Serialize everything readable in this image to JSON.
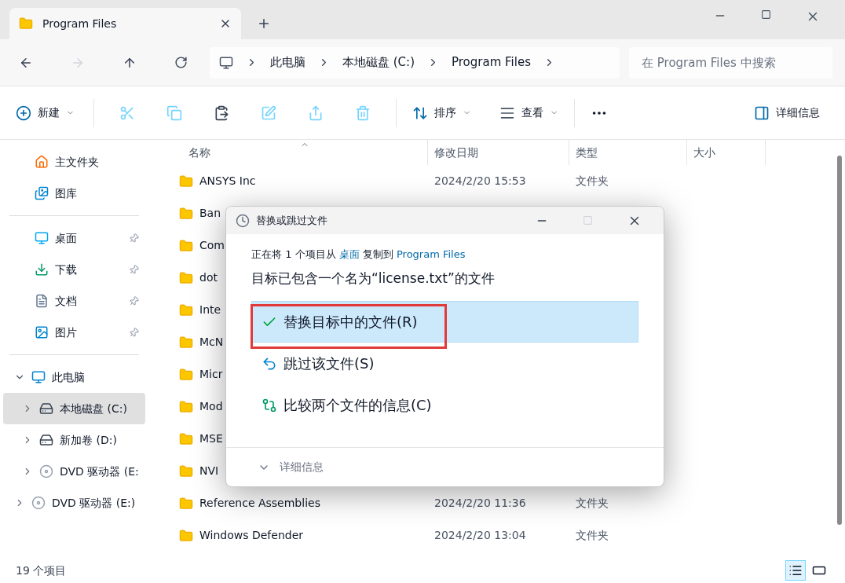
{
  "tab": {
    "title": "Program Files",
    "selected": true
  },
  "address": {
    "path": [
      {
        "label": "此电脑"
      },
      {
        "label": "本地磁盘 (C:)"
      },
      {
        "label": "Program Files"
      }
    ],
    "search_placeholder": "在 Program Files 中搜索",
    "forward_disabled": true
  },
  "toolbar": {
    "new": "新建",
    "actions": [
      {
        "kind": "cut",
        "disabled": true
      },
      {
        "kind": "copy",
        "disabled": true
      },
      {
        "kind": "paste",
        "disabled": false
      },
      {
        "kind": "rename",
        "disabled": true
      },
      {
        "kind": "share",
        "disabled": true
      },
      {
        "kind": "delete",
        "disabled": true
      }
    ],
    "sort": "排序",
    "view": "查看",
    "details": "详细信息"
  },
  "sidebar": {
    "groups": [
      [
        {
          "label": "主文件夹",
          "kind": "home",
          "pinned": false
        },
        {
          "label": "图库",
          "kind": "gallery",
          "pinned": false
        }
      ],
      [
        {
          "label": "桌面",
          "kind": "desktop",
          "pinned": true
        },
        {
          "label": "下载",
          "kind": "download",
          "pinned": true
        },
        {
          "label": "文档",
          "kind": "document",
          "pinned": true
        },
        {
          "label": "图片",
          "kind": "pictures",
          "pinned": true
        }
      ],
      [
        {
          "label": "此电脑",
          "kind": "pc",
          "expanded": true,
          "selected": false,
          "children": [
            {
              "label": "本地磁盘 (C:)",
              "kind": "system-drive",
              "expanded": false,
              "selected": true
            },
            {
              "label": "新加卷 (D:)",
              "kind": "drive",
              "expanded": false,
              "selected": false
            },
            {
              "label": "DVD 驱动器 (E:",
              "kind": "dvd",
              "expanded": false,
              "selected": false
            }
          ]
        },
        {
          "label": "DVD 驱动器 (E:)",
          "kind": "dvd",
          "expanded": false,
          "selected": false
        }
      ]
    ]
  },
  "table": {
    "columns": [
      "名称",
      "修改日期",
      "类型",
      "大小"
    ],
    "rows": [
      {
        "name": "ANSYS Inc",
        "date": "2024/2/20 15:53",
        "type": "文件夹"
      },
      {
        "name": "Ban"
      },
      {
        "name": "Com"
      },
      {
        "name": "dot"
      },
      {
        "name": "Inte"
      },
      {
        "name": "McN"
      },
      {
        "name": "Micr"
      },
      {
        "name": "Mod"
      },
      {
        "name": "MSE"
      },
      {
        "name": "NVI"
      },
      {
        "name": "Reference Assemblies",
        "date": "2024/2/20 11:36",
        "type": "文件夹"
      },
      {
        "name": "Windows Defender",
        "date": "2024/2/20 13:04",
        "type": "文件夹"
      }
    ]
  },
  "dialog": {
    "title": "替换或跳过文件",
    "message": {
      "prefix": "正在将 1 个项目从",
      "source": "桌面",
      "middle": "复制到",
      "target": "Program Files"
    },
    "heading": "目标已包含一个名为“license.txt”的文件",
    "options": [
      {
        "kind": "replace",
        "label": "替换目标中的文件(R)",
        "selected": true
      },
      {
        "kind": "skip",
        "label": "跳过该文件(S)",
        "selected": false
      },
      {
        "kind": "compare",
        "label": "比较两个文件的信息(C)",
        "selected": false
      }
    ],
    "details": "详细信息",
    "details_expanded": false
  },
  "status_bar": {
    "count": "19 个项目",
    "views": [
      {
        "kind": "details",
        "selected": true
      },
      {
        "kind": "tiles",
        "selected": false
      }
    ]
  }
}
